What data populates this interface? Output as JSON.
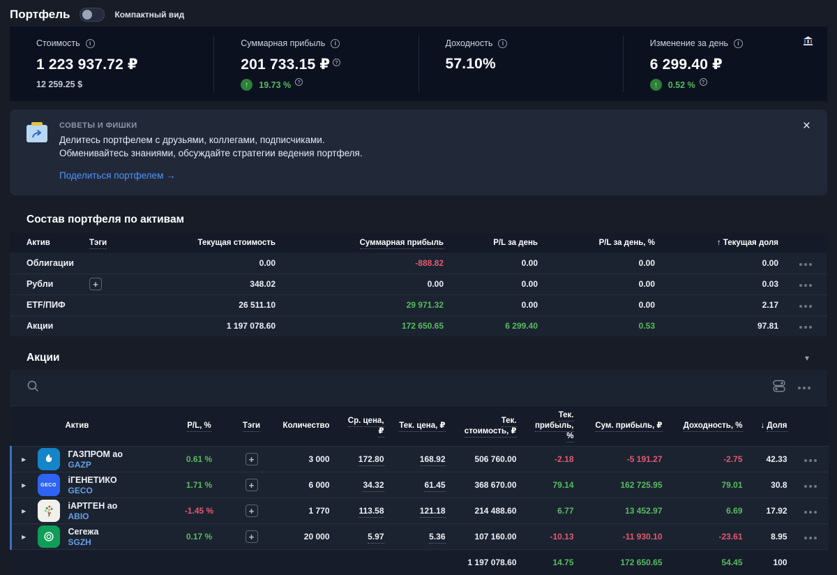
{
  "colors": {
    "pos": "#55bd5f",
    "neg": "#e25a70",
    "text": "#eef1f7",
    "muted": "#8d96a8"
  },
  "header": {
    "title": "Портфель",
    "compact_label": "Компактный вид"
  },
  "summary": {
    "cards": {
      "value": {
        "label": "Стоимость",
        "value": "1 223 937.72 ₽",
        "secondary": "12 259.25 $"
      },
      "profit": {
        "label": "Суммарная прибыль",
        "value": "201 733.15 ₽",
        "delta": "19.73 %",
        "arrow": "↑"
      },
      "yield": {
        "label": "Доходность",
        "value": "57.10%"
      },
      "day": {
        "label": "Изменение за день",
        "value": "6 299.40 ₽",
        "delta": "0.52 %",
        "arrow": "↑"
      }
    }
  },
  "banner": {
    "kicker": "СОВЕТЫ И ФИШКИ",
    "line1": "Делитесь портфелем с друзьями, коллегами, подписчиками.",
    "line2": "Обменивайтесь знаниями, обсуждайте стратегии ведения портфеля.",
    "link_label": "Поделиться портфелем →",
    "close": "×"
  },
  "assets": {
    "title": "Состав портфеля по активам",
    "columns": {
      "asset": "Актив",
      "tags": "Тэги",
      "current_value": "Текущая стоимость",
      "total_profit": "Суммарная прибыль",
      "pl_day": "P/L за день",
      "pl_day_pct": "P/L за день, %",
      "share_arrow": "↑",
      "share": "Текущая доля"
    },
    "rows": [
      {
        "name": "Облигации",
        "current_value": "0.00",
        "total_profit": "-888.82",
        "total_profit_color": "neg",
        "pl_day": "0.00",
        "pl_day_color": "text",
        "pl_day_pct": "0.00",
        "pl_day_pct_color": "text",
        "share": "0.00"
      },
      {
        "name": "Рубли",
        "current_value": "348.02",
        "total_profit": "0.00",
        "total_profit_color": "text",
        "pl_day": "0.00",
        "pl_day_color": "text",
        "pl_day_pct": "0.00",
        "pl_day_pct_color": "text",
        "share": "0.03"
      },
      {
        "name": "ETF/ПИФ",
        "current_value": "26 511.10",
        "total_profit": "29 971.32",
        "total_profit_color": "pos",
        "pl_day": "0.00",
        "pl_day_color": "text",
        "pl_day_pct": "0.00",
        "pl_day_pct_color": "text",
        "share": "2.17"
      },
      {
        "name": "Акции",
        "current_value": "1 197 078.60",
        "total_profit": "172 650.65",
        "total_profit_color": "pos",
        "pl_day": "6 299.40",
        "pl_day_color": "pos",
        "pl_day_pct": "0.53",
        "pl_day_pct_color": "pos",
        "share": "97.81"
      }
    ]
  },
  "stocks": {
    "title": "Акции",
    "collapse_arrow": "▾",
    "expander": "▶",
    "columns": {
      "asset": "Актив",
      "pl_pct": "P/L, %",
      "tags": "Тэги",
      "qty": "Количество",
      "avg_price": "Ср. цена, ₽",
      "cur_price": "Тек. цена, ₽",
      "cur_value_1": "Тек.",
      "cur_value_2": "стоимость, ₽",
      "day_profit_1": "Тек.",
      "day_profit_2": "прибыль, %",
      "total_profit": "Сум. прибыль, ₽",
      "yield": "Доходность, %",
      "share_arrow": "↓",
      "share": "Доля"
    },
    "rows": [
      {
        "name": "ГАЗПРОМ ао",
        "ticker": "GAZP",
        "pl_pct": "0.61 %",
        "pl_pct_color": "pos",
        "qty": "3 000",
        "avg_price": "172.80",
        "cur_price": "168.92",
        "cur_value": "506 760.00",
        "day_profit_pct": "-2.18",
        "day_color": "neg",
        "total_profit": "-5 191.27",
        "total_color": "neg",
        "yield_pct": "-2.75",
        "yield_color": "neg",
        "share": "42.33"
      },
      {
        "name": "iГЕНЕТИКО",
        "ticker": "GECO",
        "logo_text": "GECO",
        "pl_pct": "1.71 %",
        "pl_pct_color": "pos",
        "qty": "6 000",
        "avg_price": "34.32",
        "cur_price": "61.45",
        "cur_value": "368 670.00",
        "day_profit_pct": "79.14",
        "day_color": "pos",
        "total_profit": "162 725.95",
        "total_color": "pos",
        "yield_pct": "79.01",
        "yield_color": "pos",
        "share": "30.8"
      },
      {
        "name": "iАРТГЕН ао",
        "ticker": "ABIO",
        "pl_pct": "-1.45 %",
        "pl_pct_color": "neg",
        "qty": "1 770",
        "avg_price": "113.58",
        "cur_price": "121.18",
        "cur_value": "214 488.60",
        "day_profit_pct": "6.77",
        "day_color": "pos",
        "total_profit": "13 452.97",
        "total_color": "pos",
        "yield_pct": "6.69",
        "yield_color": "pos",
        "share": "17.92"
      },
      {
        "name": "Сегежа",
        "ticker": "SGZH",
        "pl_pct": "0.17 %",
        "pl_pct_color": "pos",
        "qty": "20 000",
        "avg_price": "5.97",
        "cur_price": "5.36",
        "cur_value": "107 160.00",
        "day_profit_pct": "-10.13",
        "day_color": "neg",
        "total_profit": "-11 930.10",
        "total_color": "neg",
        "yield_pct": "-23.61",
        "yield_color": "neg",
        "share": "8.95"
      }
    ],
    "totals": {
      "cur_value": "1 197 078.60",
      "cur_value_color": "text",
      "day_profit_pct": "14.75",
      "day_color": "pos",
      "total_profit": "172 650.65",
      "total_color": "pos",
      "yield_pct": "54.45",
      "yield_color": "pos",
      "share": "100",
      "share_color": "text"
    }
  }
}
